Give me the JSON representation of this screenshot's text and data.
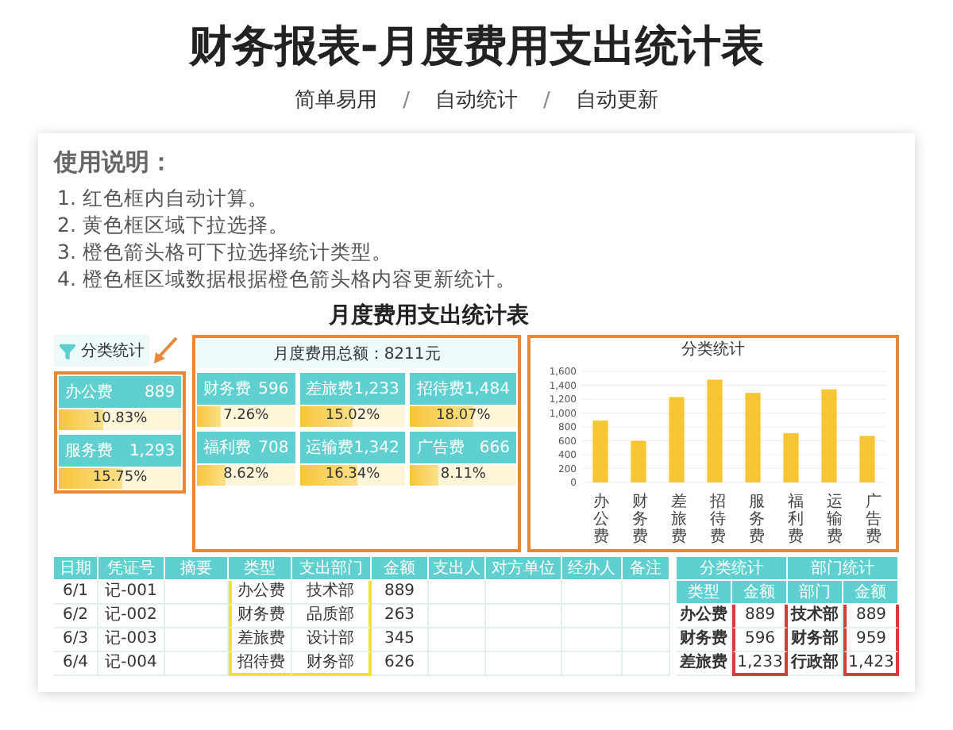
{
  "page_title": "财务报表-月度费用支出统计表",
  "features": [
    {
      "kind": "label",
      "text": "简单易用"
    },
    {
      "kind": "separator",
      "text": "/"
    },
    {
      "kind": "label",
      "text": "自动统计"
    },
    {
      "kind": "separator",
      "text": "/"
    },
    {
      "kind": "label",
      "text": "自动更新"
    }
  ],
  "instructions": {
    "heading": "使用说明：",
    "steps": [
      "1. 红色框内自动计算。",
      "2. 黄色框区域下拉选择。",
      "3. 橙色箭头格可下拉选择统计类型。",
      "4. 橙色框区域数据根据橙色箭头格内容更新统计。"
    ]
  },
  "sheet": {
    "title": "月度费用支出统计表",
    "filter_button": "分类统计",
    "total": "月度费用总额：8211元",
    "left_tiles": [
      {
        "name": "办公费",
        "amount": "889",
        "percent": "10.83%",
        "level": 0.36
      },
      {
        "name": "服务费",
        "amount": "1,293",
        "percent": "15.75%",
        "level": 0.52
      }
    ],
    "tiles": [
      {
        "name": "财务费",
        "amount": "596",
        "percent": "7.26%",
        "level": 0.24
      },
      {
        "name": "差旅费",
        "amount": "1,233",
        "percent": "15.02%",
        "level": 0.5
      },
      {
        "name": "招待费",
        "amount": "1,484",
        "percent": "18.07%",
        "level": 0.6
      },
      {
        "name": "福利费",
        "amount": "708",
        "percent": "8.62%",
        "level": 0.29
      },
      {
        "name": "运输费",
        "amount": "1,342",
        "percent": "16.34%",
        "level": 0.54
      },
      {
        "name": "广告费",
        "amount": "666",
        "percent": "8.11%",
        "level": 0.27
      }
    ],
    "chart_data": {
      "type": "bar",
      "title": "分类统计",
      "grid": true,
      "categories": [
        "办公费",
        "财务费",
        "差旅费",
        "招待费",
        "服务费",
        "福利费",
        "运输费",
        "广告费"
      ],
      "series": [
        {
          "color": "#f5c533",
          "values": [
            890,
            600,
            1230,
            1480,
            1290,
            710,
            1340,
            670
          ]
        }
      ],
      "ylim": [
        0,
        1600
      ],
      "yticks": [
        0,
        {
          "value": 200,
          "label": "200"
        },
        {
          "value": 400,
          "label": "400"
        },
        {
          "value": 600,
          "label": "600"
        },
        {
          "value": 800,
          "label": "800"
        },
        {
          "value": 1000,
          "label": "1,000"
        },
        {
          "value": 1200,
          "label": "1,200"
        },
        {
          "value": 1400,
          "label": "1,400"
        },
        {
          "value": 1600,
          "label": "1,600"
        }
      ]
    },
    "ledger": {
      "columns": [
        {
          "label": "日期",
          "framed": false
        },
        {
          "label": "凭证号",
          "framed": false
        },
        {
          "label": "摘要",
          "framed": false
        },
        {
          "label": "类型",
          "framed": true
        },
        {
          "label": "支出部门",
          "framed": true
        },
        {
          "label": "金额",
          "framed": false
        },
        {
          "label": "支出人",
          "framed": false
        },
        {
          "label": "对方单位",
          "framed": false
        },
        {
          "label": "经办人",
          "framed": false
        },
        {
          "label": "备注",
          "framed": false
        }
      ],
      "rows": [
        [
          "6/1",
          "记-001",
          "",
          "办公费",
          "技术部",
          "889",
          "",
          "",
          "",
          ""
        ],
        [
          "6/2",
          "记-002",
          "",
          "财务费",
          "品质部",
          "263",
          "",
          "",
          "",
          ""
        ],
        [
          "6/3",
          "记-003",
          "",
          "差旅费",
          "设计部",
          "345",
          "",
          "",
          "",
          ""
        ],
        [
          "6/4",
          "记-004",
          "",
          "招待费",
          "财务部",
          "626",
          "",
          "",
          "",
          ""
        ]
      ]
    },
    "summaries": [
      {
        "title": "分类统计",
        "columns": [
          {
            "label": "类型",
            "framed": false
          },
          {
            "label": "金额",
            "framed": true
          }
        ],
        "rows": [
          [
            "办公费",
            "889"
          ],
          [
            "财务费",
            "596"
          ],
          [
            "差旅费",
            "1,233"
          ]
        ]
      },
      {
        "title": "部门统计",
        "columns": [
          {
            "label": "部门",
            "framed": false
          },
          {
            "label": "金额",
            "framed": true
          }
        ],
        "rows": [
          [
            "技术部",
            "889"
          ],
          [
            "财务部",
            "959"
          ],
          [
            "行政部",
            "1,423"
          ]
        ]
      }
    ]
  }
}
